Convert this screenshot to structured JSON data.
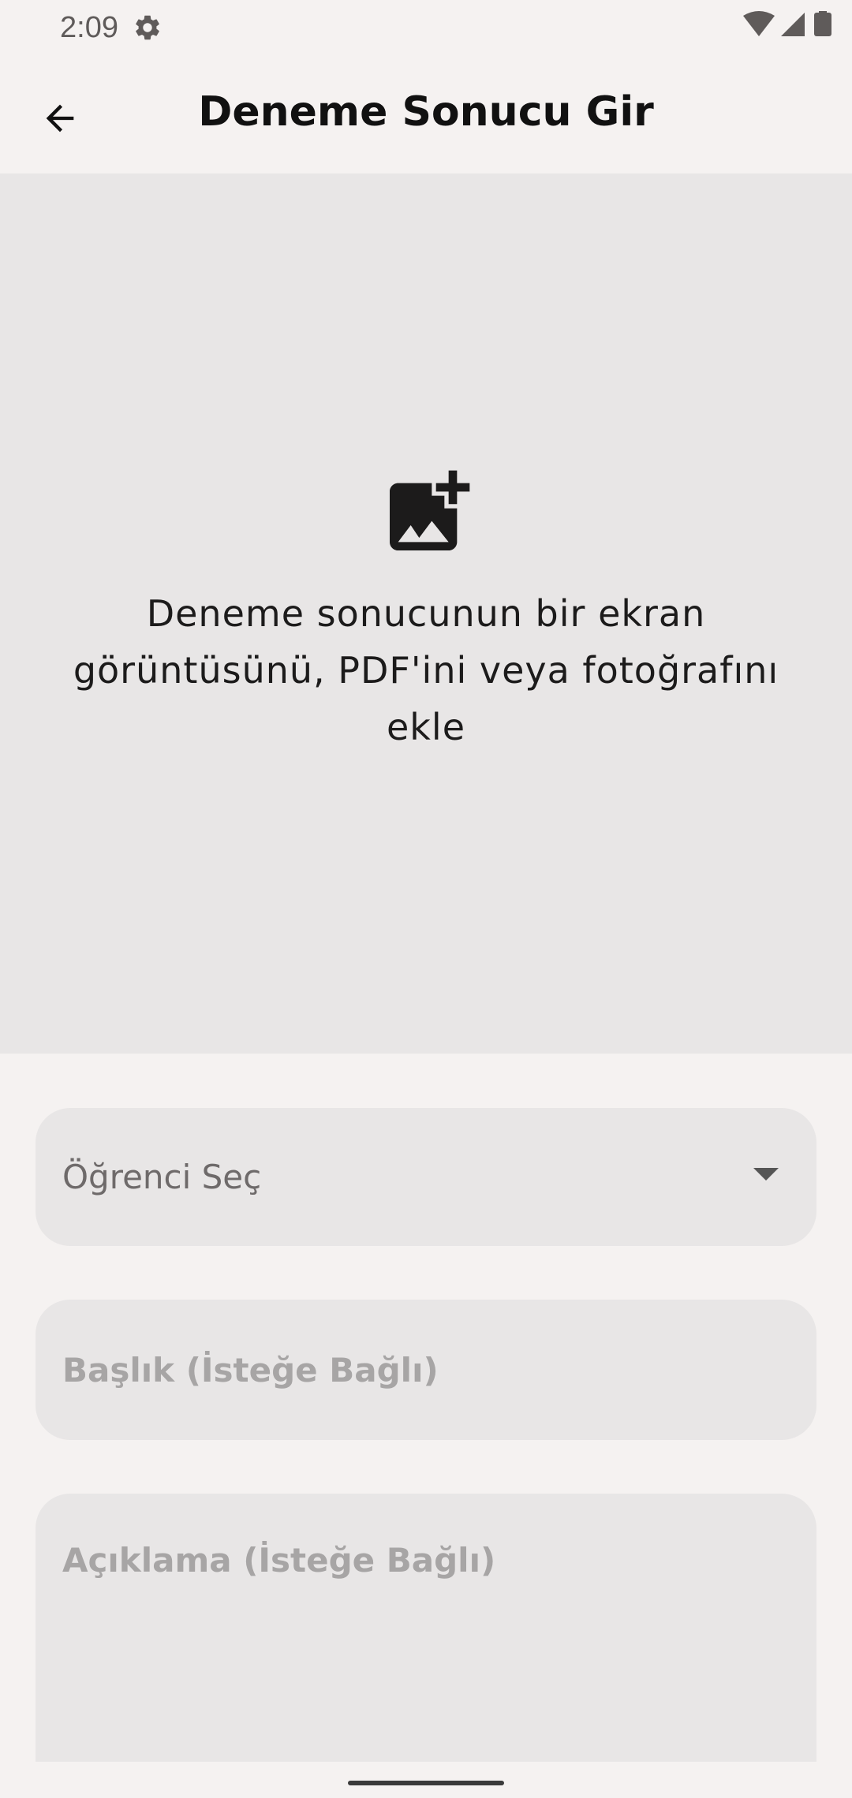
{
  "status_bar": {
    "time": "2:09",
    "icons": [
      "gear-icon",
      "wifi-icon",
      "signal-icon",
      "battery-icon"
    ]
  },
  "app_bar": {
    "title": "Deneme Sonucu Gir",
    "back_icon": "arrow-back-icon"
  },
  "upload": {
    "icon": "add-photo-icon",
    "text": "Deneme sonucunun bir ekran görüntüsünü, PDF'ini veya fotoğrafını ekle"
  },
  "form": {
    "student_select": {
      "value": "Öğrenci Seç",
      "icon": "dropdown-arrow-icon"
    },
    "title_field": {
      "placeholder": "Başlık (İsteğe Bağlı)",
      "value": ""
    },
    "description_field": {
      "placeholder": "Açıklama (İsteğe Bağlı)",
      "value": ""
    }
  },
  "colors": {
    "background": "#f5f2f1",
    "surface": "#e8e6e6",
    "text_primary": "#111111",
    "placeholder": "#a7a5a5"
  }
}
